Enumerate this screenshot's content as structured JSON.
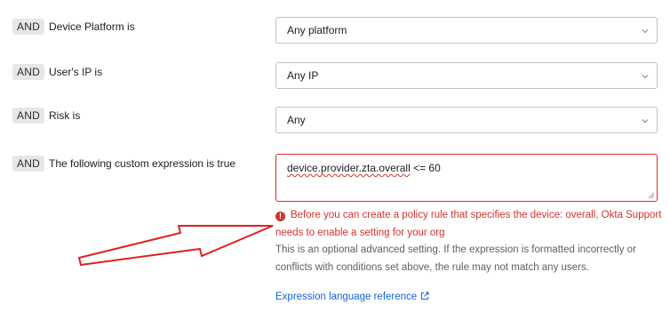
{
  "conditions": [
    {
      "operator": "AND",
      "label": "Device Platform is",
      "value": "Any platform"
    },
    {
      "operator": "AND",
      "label": "User's IP is",
      "value": "Any IP"
    },
    {
      "operator": "AND",
      "label": "Risk is",
      "value": "Any"
    },
    {
      "operator": "AND",
      "label": "The following custom expression is true"
    }
  ],
  "expression": {
    "text_underlined": "device.provider.zta.overall",
    "text_rest": " <= 60"
  },
  "error_message": "Before you can create a policy rule that specifies the device: overall, Okta Support needs to enable a setting for your org",
  "help_text": "This is an optional advanced setting. If the expression is formatted incorrectly or conflicts with conditions set above, the rule may not match any users.",
  "reference_link": "Expression language reference",
  "colors": {
    "error": "#d4322c",
    "link": "#1662dd",
    "annotation_arrow": "#e02020",
    "badge_bg": "#e7e7e9"
  },
  "icons": [
    "chevron-down-icon",
    "error-icon",
    "external-link-icon",
    "resize-grip-icon"
  ]
}
